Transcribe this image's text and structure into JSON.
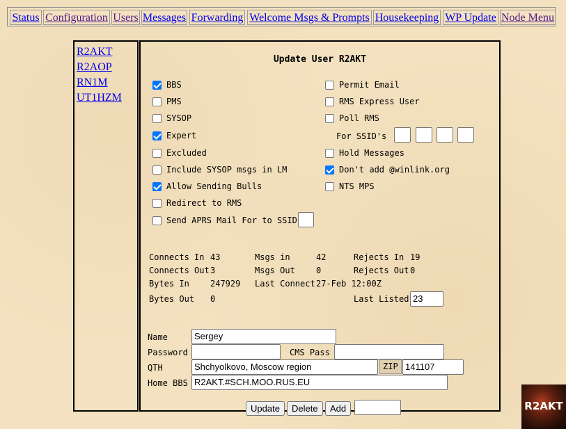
{
  "nav": {
    "status": "Status",
    "configuration": "Configuration",
    "users": "Users",
    "messages": "Messages",
    "forwarding": "Forwarding",
    "welcome": "Welcome Msgs & Prompts",
    "housekeeping": "Housekeeping",
    "wp_update": "WP Update",
    "node_menu": "Node Menu"
  },
  "users": [
    "R2AKT",
    "R2AOP",
    "RN1M",
    "UT1HZM"
  ],
  "form": {
    "title": "Update User R2AKT",
    "left_options": [
      {
        "label": "BBS",
        "checked": true
      },
      {
        "label": "PMS",
        "checked": false
      },
      {
        "label": "SYSOP",
        "checked": false
      },
      {
        "label": "Expert",
        "checked": true
      },
      {
        "label": "Excluded",
        "checked": false
      },
      {
        "label": "Include SYSOP msgs in LM",
        "checked": false
      },
      {
        "label": "Allow Sending Bulls",
        "checked": true
      },
      {
        "label": "Redirect to RMS",
        "checked": false
      },
      {
        "label": "Send APRS Mail For to SSID",
        "checked": false
      }
    ],
    "right_options": [
      {
        "label": "Permit Email",
        "checked": false
      },
      {
        "label": "RMS Express User",
        "checked": false
      },
      {
        "label": "Poll RMS",
        "checked": false
      },
      {
        "label": "Hold Messages",
        "checked": false
      },
      {
        "label": "Don't add @winlink.org",
        "checked": true
      },
      {
        "label": "NTS MPS",
        "checked": false
      }
    ],
    "ssid_label": "For SSID's",
    "stats": {
      "connects_in_label": "Connects In",
      "connects_in": "43",
      "connects_out_label": "Connects Out",
      "connects_out": "3",
      "bytes_in_label": "Bytes In",
      "bytes_in": "247929",
      "bytes_out_label": "Bytes Out",
      "bytes_out": "0",
      "msgs_in_label": "Msgs in",
      "msgs_in": "42",
      "msgs_out_label": "Msgs Out",
      "msgs_out": "0",
      "last_connect_label": "Last Connect",
      "last_connect": "27-Feb 12:00Z",
      "rejects_in_label": "Rejects In",
      "rejects_in": "19",
      "rejects_out_label": "Rejects Out",
      "rejects_out": "0",
      "last_listed_label": "Last Listed",
      "last_listed": "23"
    },
    "fields": {
      "name_label": "Name",
      "name": "Sergey",
      "password_label": "Password",
      "password": "",
      "cms_pass_label": "CMS Pass",
      "cms_pass": "",
      "qth_label": "QTH",
      "qth": "Shchyolkovo, Moscow region",
      "zip_label": "ZIP",
      "zip": "141107",
      "home_bbs_label": "Home BBS",
      "home_bbs": "R2AKT.#SCH.MOO.RUS.EU"
    },
    "buttons": {
      "update": "Update",
      "delete": "Delete",
      "add": "Add",
      "add_value": ""
    }
  },
  "logo": {
    "text": "R2AKT"
  }
}
